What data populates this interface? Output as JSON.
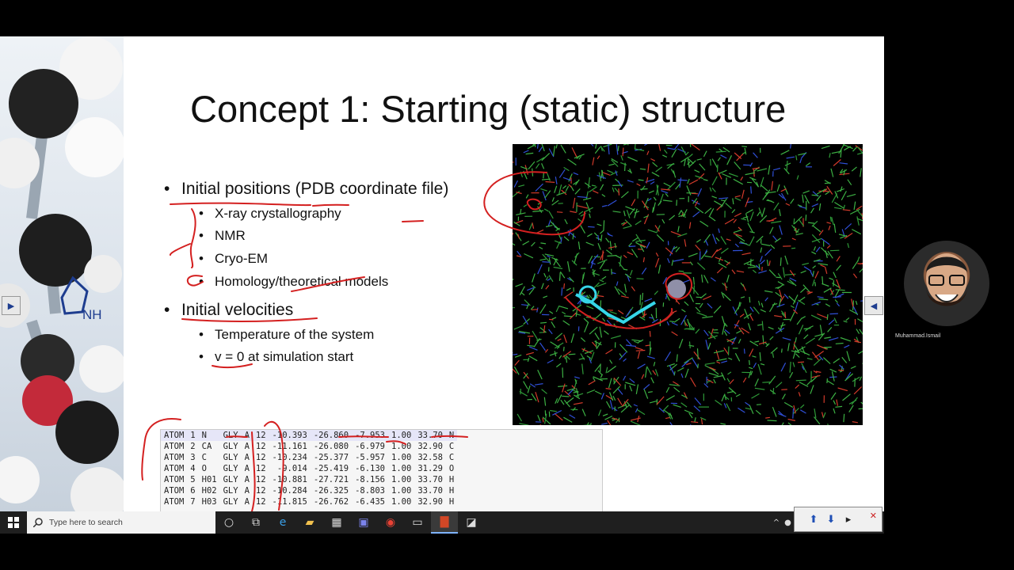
{
  "slide": {
    "title": "Concept 1: Starting (static) structure",
    "bullets": [
      {
        "text": "Initial positions (PDB coordinate file)",
        "subitems": [
          "X-ray crystallography",
          "NMR",
          "Cryo-EM",
          "Homology/theoretical models"
        ]
      },
      {
        "text": "Initial velocities",
        "subitems": [
          "Temperature of the system",
          "v = 0 at simulation start"
        ]
      }
    ],
    "deco_label": "NH"
  },
  "pdb_rows": [
    [
      "ATOM",
      "1",
      "N",
      "GLY",
      "A",
      "12",
      "-10.393",
      "-26.860",
      "-7.953",
      "1.00",
      "33.70",
      "N"
    ],
    [
      "ATOM",
      "2",
      "CA",
      "GLY",
      "A",
      "12",
      "-11.161",
      "-26.080",
      "-6.979",
      "1.00",
      "32.90",
      "C"
    ],
    [
      "ATOM",
      "3",
      "C",
      "GLY",
      "A",
      "12",
      "-10.234",
      "-25.377",
      "-5.957",
      "1.00",
      "32.58",
      "C"
    ],
    [
      "ATOM",
      "4",
      "O",
      "GLY",
      "A",
      "12",
      "-9.014",
      "-25.419",
      "-6.130",
      "1.00",
      "31.29",
      "O"
    ],
    [
      "ATOM",
      "5",
      "H01",
      "GLY",
      "A",
      "12",
      "-10.881",
      "-27.721",
      "-8.156",
      "1.00",
      "33.70",
      "H"
    ],
    [
      "ATOM",
      "6",
      "H02",
      "GLY",
      "A",
      "12",
      "-10.284",
      "-26.325",
      "-8.803",
      "1.00",
      "33.70",
      "H"
    ],
    [
      "ATOM",
      "7",
      "H03",
      "GLY",
      "A",
      "12",
      "-11.815",
      "-26.762",
      "-6.435",
      "1.00",
      "32.90",
      "H"
    ]
  ],
  "presenter": {
    "name": "Muhammad.Ismail"
  },
  "taskbar": {
    "search_placeholder": "Type here to search",
    "apps": [
      "task-view-icon",
      "edge-icon",
      "file-explorer-icon",
      "store-icon",
      "teams-icon",
      "chrome-icon",
      "app-icon",
      "powerpoint-icon",
      "whiteboard-icon"
    ]
  },
  "colors": {
    "slide_bg": "#ffffff",
    "ink_red": "#d42020",
    "taskbar": "#1f1f1f",
    "accent": "#1e3d8f"
  }
}
